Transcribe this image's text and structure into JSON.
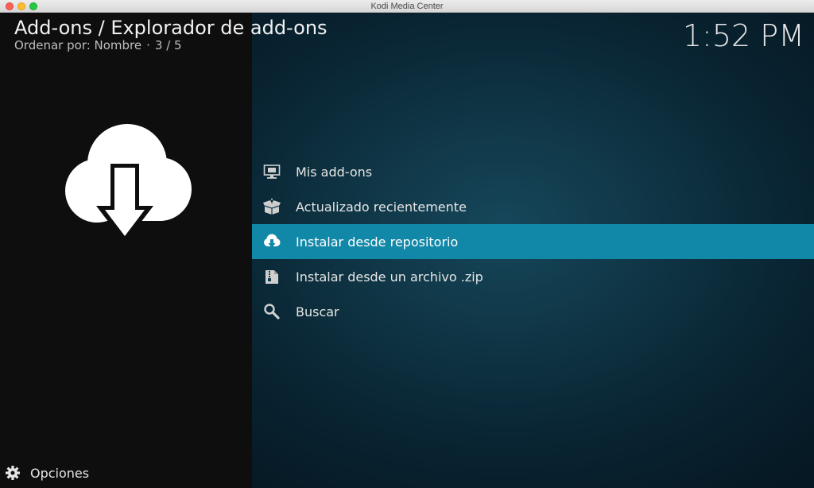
{
  "window": {
    "title": "Kodi Media Center"
  },
  "header": {
    "breadcrumb": "Add-ons / Explorador de add-ons",
    "sort_label": "Ordenar por: Nombre",
    "sort_separator": "·",
    "position": "3 / 5",
    "clock": "1:52 PM"
  },
  "menu": {
    "focused_index": 2,
    "items": [
      {
        "label": "Mis add-ons",
        "icon": "monitor-addons-icon"
      },
      {
        "label": "Actualizado recientemente",
        "icon": "open-box-icon"
      },
      {
        "label": "Instalar desde repositorio",
        "icon": "cloud-download-icon"
      },
      {
        "label": "Instalar desde un archivo .zip",
        "icon": "zip-file-icon"
      },
      {
        "label": "Buscar",
        "icon": "search-icon"
      }
    ]
  },
  "footer": {
    "options_label": "Opciones"
  },
  "colors": {
    "focus_highlight": "#1288a8",
    "left_pane_bg": "#0e0e0e",
    "right_pane_bg": "#0f3545",
    "text": "#e6e6e6"
  }
}
